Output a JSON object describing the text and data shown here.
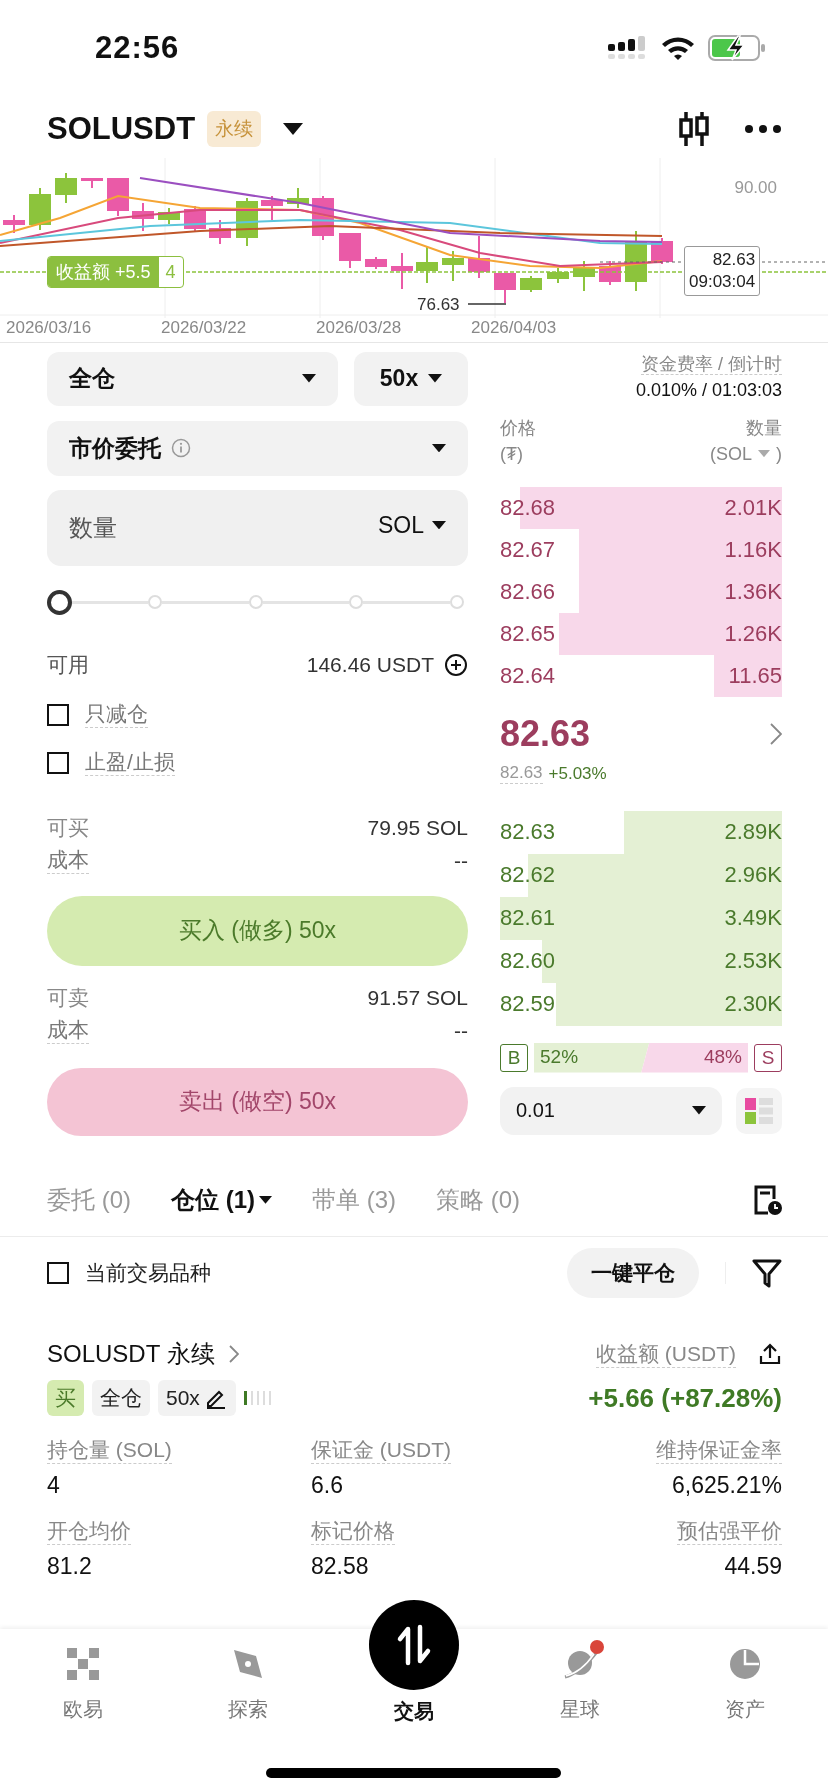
{
  "status_bar": {
    "time": "22:56"
  },
  "header": {
    "symbol": "SOLUSDT",
    "badge": "永续"
  },
  "chart": {
    "axis_label": "90.00",
    "last_price": "82.63",
    "countdown": "09:03:04",
    "low_price": "76.63",
    "pnl_tag": {
      "label": "收益额 +5.5",
      "qty": "4"
    },
    "dates": [
      "2026/03/16",
      "2026/03/22",
      "2026/03/28",
      "2026/04/03"
    ]
  },
  "order_form": {
    "margin_mode": "全仓",
    "leverage": "50x",
    "order_type": "市价委托",
    "quantity": {
      "placeholder": "数量",
      "unit": "SOL"
    },
    "slider": {
      "level": 0
    },
    "available": {
      "label": "可用",
      "value": "146.46 USDT"
    },
    "options": [
      {
        "label": "只减仓",
        "checked": false
      },
      {
        "label": "止盈/止损",
        "checked": false
      }
    ],
    "buy": {
      "max_label": "可买",
      "max_value": "79.95 SOL",
      "cost_label": "成本",
      "cost_value": "--",
      "button": "买入 (做多) 50x"
    },
    "sell": {
      "max_label": "可卖",
      "max_value": "91.57 SOL",
      "cost_label": "成本",
      "cost_value": "--",
      "button": "卖出 (做空) 50x"
    }
  },
  "order_book": {
    "funding_label": "资金费率 / 倒计时",
    "funding_value": "0.010% / 01:03:03",
    "price_header": "价格",
    "price_unit": "(₮)",
    "qty_header": "数量",
    "qty_unit": "(SOL",
    "qty_unit_end": ")",
    "asks": [
      {
        "price": "82.68",
        "qty": "2.01K"
      },
      {
        "price": "82.67",
        "qty": "1.16K"
      },
      {
        "price": "82.66",
        "qty": "1.36K"
      },
      {
        "price": "82.65",
        "qty": "1.26K"
      },
      {
        "price": "82.64",
        "qty": "11.65"
      }
    ],
    "last_price": "82.63",
    "mark_price": "82.63",
    "change": "+5.03%",
    "bids": [
      {
        "price": "82.63",
        "qty": "2.89K"
      },
      {
        "price": "82.62",
        "qty": "2.96K"
      },
      {
        "price": "82.61",
        "qty": "3.49K"
      },
      {
        "price": "82.60",
        "qty": "2.53K"
      },
      {
        "price": "82.59",
        "qty": "2.30K"
      }
    ],
    "buy_ratio": {
      "letter": "B",
      "label": "52%"
    },
    "sell_ratio": {
      "letter": "S",
      "label": "48%"
    },
    "precision": "0.01"
  },
  "tabs": [
    {
      "label": "委托 (0)",
      "selected": false
    },
    {
      "label": "仓位 (1)",
      "selected": true,
      "menu": true
    },
    {
      "label": "带单 (3)",
      "selected": false
    },
    {
      "label": "策略 (0)",
      "selected": false
    }
  ],
  "filter": {
    "label": "当前交易品种",
    "checked": false,
    "close_all": "一键平仓"
  },
  "position": {
    "title": "SOLUSDT 永续",
    "side": "买",
    "margin_mode": "全仓",
    "leverage": "50x",
    "pnl_label": "收益额 (USDT)",
    "pnl_value": "+5.66 (+87.28%)",
    "fields": [
      {
        "label": "持仓量 (SOL)",
        "value": "4"
      },
      {
        "label": "保证金 (USDT)",
        "value": "6.6"
      },
      {
        "label": "维持保证金率",
        "value": "6,625.21%"
      },
      {
        "label": "开仓均价",
        "value": "81.2"
      },
      {
        "label": "标记价格",
        "value": "82.58"
      },
      {
        "label": "预估强平价",
        "value": "44.59"
      }
    ]
  },
  "nav": [
    {
      "label": "欧易",
      "kind": "home",
      "selected": false
    },
    {
      "label": "探索",
      "kind": "explore",
      "selected": false
    },
    {
      "label": "交易",
      "kind": "trade",
      "selected": true
    },
    {
      "label": "星球",
      "kind": "planet",
      "selected": false,
      "badge": true
    },
    {
      "label": "资产",
      "kind": "assets",
      "selected": false
    }
  ]
}
